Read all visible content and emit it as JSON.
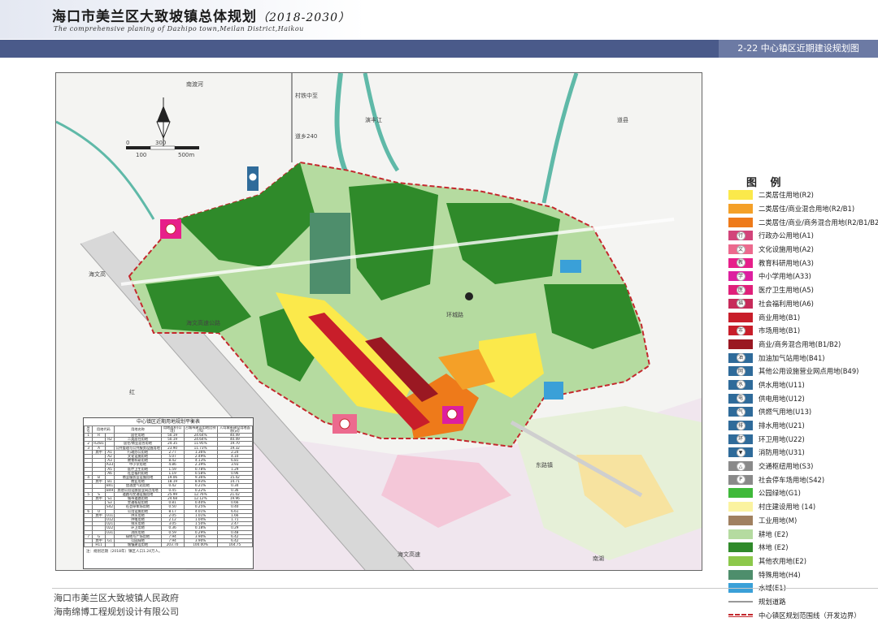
{
  "header": {
    "title": "海口市美兰区大致坡镇总体规划",
    "title_year": "（2018-2030）",
    "subtitle": "The comprehensive planing of Dazhipo town,Meilan District,Haikou",
    "sheet_label": "2-22 中心镇区近期建设规划图"
  },
  "colors": {
    "header_bar": "#4a5a8a",
    "sheet_tab": "#6c7aa4",
    "boundary": "#c4282d",
    "forest": "#2f8a2a",
    "farmland": "#b5dba0",
    "residential": "#fbe94b",
    "water": "#3aa0d8"
  },
  "map": {
    "labels": {
      "north_road": "村铁中至",
      "road_vertical": "道乡240",
      "haiwen_road": "海文高速公路",
      "east_road": "东路镇",
      "river": "南渡河",
      "village_n": "演丰江",
      "road_ne": "道县",
      "road_w": "海文高",
      "ring_road": "环城路",
      "red_label": "红",
      "south_road": "海文高速",
      "bay_label": "南湖"
    },
    "scale": {
      "t0": "0",
      "t100": "100",
      "t300": "300",
      "t500": "500m"
    }
  },
  "legend": {
    "title": "图  例",
    "items": [
      {
        "label": "二类居住用地(R2)",
        "color": "#fbe94b",
        "icon": "",
        "icon_name": "residential-swatch"
      },
      {
        "label": "二类居住/商业混合用地(R2/B1)",
        "color": "#f4a028",
        "icon": "",
        "icon_name": "mixed-swatch"
      },
      {
        "label": "二类居住/商业/商务混合用地(R2/B1/B2)",
        "color": "#ee7a1a",
        "icon": "",
        "icon_name": "mixed-swatch"
      },
      {
        "label": "行政办公用地(A1)",
        "color": "#d2447a",
        "icon": "行",
        "icon_name": "admin-icon"
      },
      {
        "label": "文化设施用地(A2)",
        "color": "#ec6a8e",
        "icon": "文",
        "icon_name": "culture-icon"
      },
      {
        "label": "教育科研用地(A3)",
        "color": "#e71f8a",
        "icon": "教",
        "icon_name": "education-icon"
      },
      {
        "label": "中小学用地(A33)",
        "color": "#dd1fa0",
        "icon": "学",
        "icon_name": "school-icon"
      },
      {
        "label": "医疗卫生用地(A5)",
        "color": "#e0207a",
        "icon": "医",
        "icon_name": "hospital-icon"
      },
      {
        "label": "社会福利用地(A6)",
        "color": "#c72a5a",
        "icon": "福",
        "icon_name": "welfare-icon"
      },
      {
        "label": "商业用地(B1)",
        "color": "#c81e2a",
        "icon": "",
        "icon_name": "commercial-swatch"
      },
      {
        "label": "市场用地(B1)",
        "color": "#c81e2a",
        "icon": "市",
        "icon_name": "market-icon"
      },
      {
        "label": "商业/商务混合用地(B1/B2)",
        "color": "#9a1822",
        "icon": "",
        "icon_name": "business-swatch"
      },
      {
        "label": "加油加气站用地(B41)",
        "color": "#2f6b9a",
        "icon": "油",
        "icon_name": "gas-station-icon"
      },
      {
        "label": "其他公用设施营业网点用地(B49)",
        "color": "#2f6b9a",
        "icon": "网",
        "icon_name": "utility-outlet-icon"
      },
      {
        "label": "供水用地(U11)",
        "color": "#2f6b9a",
        "icon": "水",
        "icon_name": "water-supply-icon"
      },
      {
        "label": "供电用地(U12)",
        "color": "#2f6b9a",
        "icon": "电",
        "icon_name": "power-icon"
      },
      {
        "label": "供燃气用地(U13)",
        "color": "#2f6b9a",
        "icon": "气",
        "icon_name": "gas-icon"
      },
      {
        "label": "排水用地(U21)",
        "color": "#2f6b9a",
        "icon": "排",
        "icon_name": "drainage-icon"
      },
      {
        "label": "环卫用地(U22)",
        "color": "#2f6b9a",
        "icon": "环",
        "icon_name": "sanitation-icon"
      },
      {
        "label": "消防用地(U31)",
        "color": "#2f6b9a",
        "icon": "▼",
        "icon_name": "fire-station-icon"
      },
      {
        "label": "交通枢纽用地(S3)",
        "color": "#8a8a8a",
        "icon": "△",
        "icon_name": "transit-hub-icon"
      },
      {
        "label": "社会停车场用地(S42)",
        "color": "#8a8a8a",
        "icon": "P",
        "icon_name": "parking-icon"
      },
      {
        "label": "公园绿地(G1)",
        "color": "#3fb93a",
        "icon": "",
        "icon_name": "park-swatch"
      },
      {
        "label": "村庄建设用地 (14)",
        "color": "#fbf3a0",
        "icon": "",
        "icon_name": "village-swatch"
      },
      {
        "label": "工业用地(M)",
        "color": "#a08060",
        "icon": "",
        "icon_name": "industrial-swatch"
      },
      {
        "label": "耕地 (E2)",
        "color": "#b5dba0",
        "icon": "",
        "icon_name": "farmland-swatch"
      },
      {
        "label": "林地 (E2)",
        "color": "#2f8a2a",
        "icon": "",
        "icon_name": "forest-swatch"
      },
      {
        "label": "其他农用地(E2)",
        "color": "#8cc84a",
        "icon": "",
        "icon_name": "agri-swatch"
      },
      {
        "label": "特殊用地(H4)",
        "color": "#4e8e6c",
        "icon": "",
        "icon_name": "special-swatch"
      },
      {
        "label": "水域(E1)",
        "color": "#3aa0d8",
        "icon": "",
        "icon_name": "water-swatch"
      },
      {
        "label": "规划道路",
        "color": "",
        "icon": "",
        "icon_name": "road-line"
      },
      {
        "label": "中心镇区规划范围线（开发边界）",
        "color": "",
        "icon": "",
        "icon_name": "boundary-line"
      }
    ]
  },
  "table": {
    "title": "中心镇区近期用地规划平衡表",
    "headers": [
      "序号",
      "用地代码",
      "",
      "用地名称",
      "用地面积(公顷)",
      "占城市建设用地比例(%)",
      "人均城市建设用地面积(㎡)"
    ],
    "rows": [
      [
        "1",
        "R",
        "",
        "居住用地",
        "50.19",
        "24.64%",
        "40.49"
      ],
      [
        "",
        "",
        "R2",
        "二类居住用地",
        "50.19",
        "24.64%",
        "40.49"
      ],
      [
        "2",
        "R2/B1",
        "",
        "居住/商业混合用地",
        "24.35",
        "11.95%",
        "19.70"
      ],
      [
        "3",
        "A",
        "",
        "公共管理与公共服务设施用地",
        "23.90",
        "11.73%",
        "19.32"
      ],
      [
        "",
        "其中",
        "A1",
        "行政办公用地",
        "2.77",
        "1.36%",
        "2.24"
      ],
      [
        "",
        "",
        "A2",
        "文化设施用地",
        "5.07",
        "2.49%",
        "4.10"
      ],
      [
        "",
        "",
        "A3",
        "教育科研用地",
        "8.42",
        "4.13%",
        "6.81"
      ],
      [
        "",
        "",
        "A33",
        "中小学用地",
        "4.86",
        "2.39%",
        "3.93"
      ],
      [
        "",
        "",
        "A5",
        "医疗卫生用地",
        "1.59",
        "0.78%",
        "1.29"
      ],
      [
        "",
        "",
        "A6",
        "社会福利用地",
        "1.19",
        "0.58%",
        "0.96"
      ],
      [
        "4",
        "B",
        "",
        "商业服务业设施用地",
        "19.06",
        "9.36%",
        "15.42"
      ],
      [
        "",
        "其中",
        "B1",
        "商业用地",
        "18.19",
        "8.93%",
        "14.71"
      ],
      [
        "",
        "",
        "B41",
        "加油加气站用地",
        "0.42",
        "0.21%",
        "0.34"
      ],
      [
        "",
        "",
        "B49",
        "其他公用设施营业网点用地",
        "0.45",
        "0.22%",
        "0.36"
      ],
      [
        "5",
        "S",
        "",
        "道路与交通设施用地",
        "25.99",
        "12.76%",
        "21.02"
      ],
      [
        "",
        "其中",
        "S1",
        "城市道路用地",
        "24.68",
        "12.12%",
        "19.96"
      ],
      [
        "",
        "",
        "S3",
        "交通枢纽用地",
        "0.81",
        "0.40%",
        "0.66"
      ],
      [
        "",
        "",
        "S42",
        "社会停车场用地",
        "0.50",
        "0.25%",
        "0.40"
      ],
      [
        "6",
        "U",
        "",
        "公用设施用地",
        "8.17",
        "4.01%",
        "6.61"
      ],
      [
        "",
        "其中",
        "U11",
        "供水用地",
        "2.05",
        "1.01%",
        "1.66"
      ],
      [
        "",
        "",
        "U12",
        "供电用地",
        "2.12",
        "1.04%",
        "1.71"
      ],
      [
        "",
        "",
        "U21",
        "排水用地",
        "3.05",
        "1.50%",
        "2.47"
      ],
      [
        "",
        "",
        "U22",
        "环卫用地",
        "0.36",
        "0.18%",
        "0.29"
      ],
      [
        "",
        "",
        "U31",
        "消防用地",
        "0.59",
        "0.29%",
        "0.48"
      ],
      [
        "7",
        "G",
        "",
        "绿地与广场用地",
        "7.94",
        "3.90%",
        "6.42"
      ],
      [
        "",
        "其中",
        "G1",
        "公园绿地",
        "7.94",
        "3.90%",
        "6.42"
      ],
      [
        "",
        "H11",
        "",
        "城镇建设用地",
        "203.70",
        "100.00%",
        "164.75"
      ]
    ],
    "note": "注：规划近期（2018年）镇区人口1.24万人。"
  },
  "footer": {
    "line1": "海口市美兰区大致坡镇人民政府",
    "line2": "海南绵博工程规划设计有限公司"
  }
}
